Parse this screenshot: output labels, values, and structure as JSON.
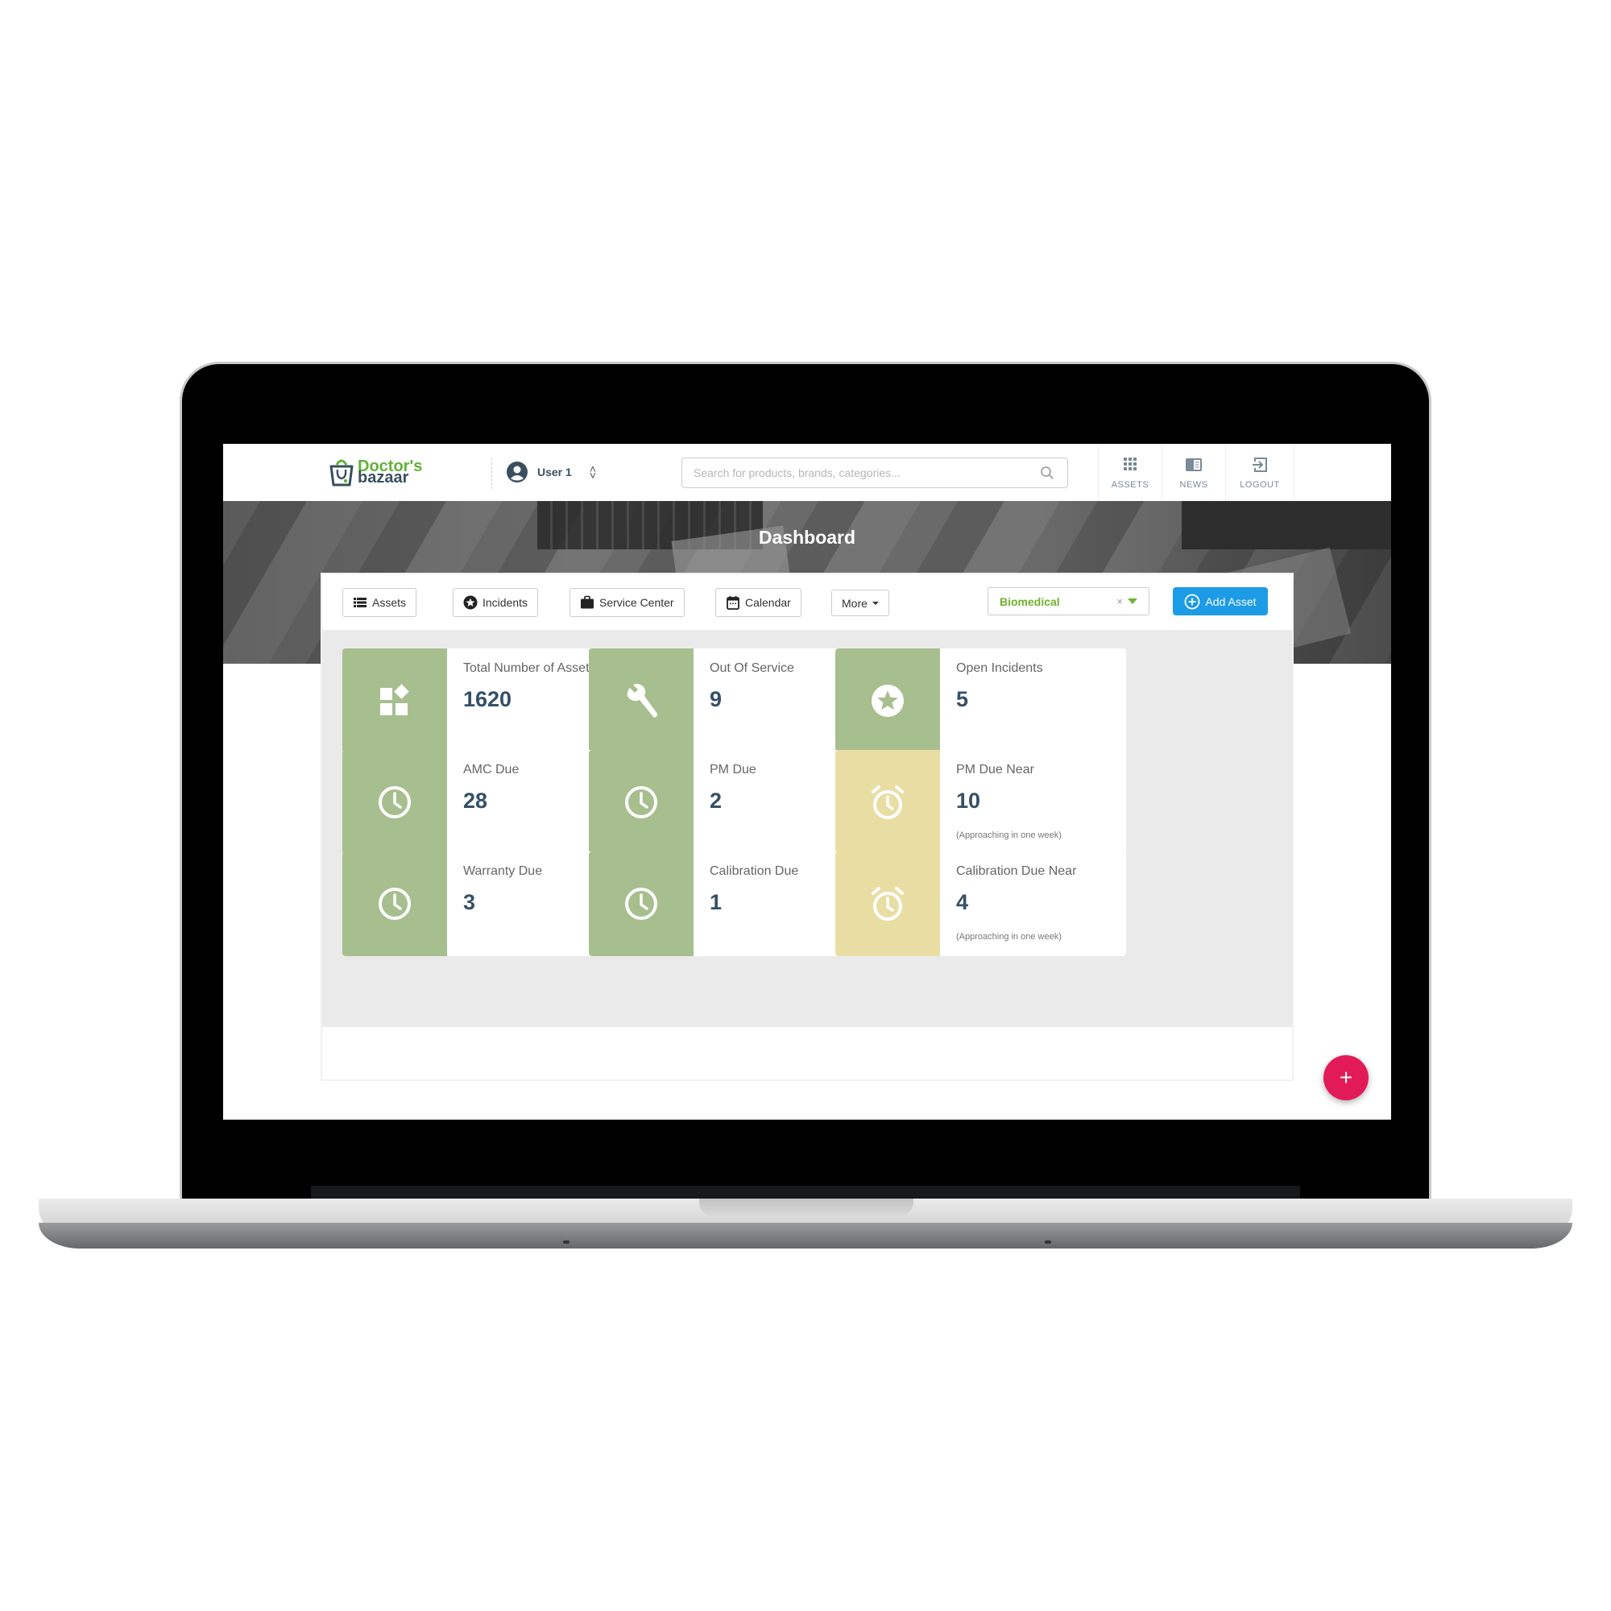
{
  "header": {
    "logo": {
      "line1": "Doctor's",
      "line2": "bazaar"
    },
    "user": {
      "name": "User 1",
      "toggle_icon": "chevron-up-down"
    },
    "search": {
      "placeholder": "Search for products, brands, categories...",
      "value": "",
      "icon": "search-icon"
    },
    "nav": [
      {
        "label": "ASSETS",
        "icon": "grid-icon"
      },
      {
        "label": "NEWS",
        "icon": "newspaper-icon"
      },
      {
        "label": "LOGOUT",
        "icon": "logout-icon"
      }
    ]
  },
  "banner": {
    "title": "Dashboard"
  },
  "toolbar": {
    "buttons": [
      {
        "label": "Assets",
        "icon": "list-icon"
      },
      {
        "label": "Incidents",
        "icon": "star-circle-icon"
      },
      {
        "label": "Service Center",
        "icon": "briefcase-icon"
      },
      {
        "label": "Calendar",
        "icon": "calendar-icon"
      },
      {
        "label": "More",
        "icon": "caret-down-icon"
      }
    ],
    "department_select": {
      "value": "Biomedical",
      "clear": "×"
    },
    "add_asset_label": "Add Asset"
  },
  "colors": {
    "green": "#a7bf8f",
    "yellow": "#e8dea4",
    "accent_blue": "#1c9be6",
    "fab": "#e21b58",
    "value_text": "#355068",
    "select_text": "#6fb22c"
  },
  "cards": [
    {
      "label": "Total Number of Assets",
      "value": "1620",
      "note": "",
      "icon": "widgets-icon",
      "tone": "green"
    },
    {
      "label": "Out Of Service",
      "value": "9",
      "note": "",
      "icon": "wrench-icon",
      "tone": "green"
    },
    {
      "label": "Open Incidents",
      "value": "5",
      "note": "",
      "icon": "star-circle-icon",
      "tone": "green"
    },
    {
      "label": "AMC Due",
      "value": "28",
      "note": "",
      "icon": "clock-icon",
      "tone": "green"
    },
    {
      "label": "PM Due",
      "value": "2",
      "note": "",
      "icon": "clock-icon",
      "tone": "green"
    },
    {
      "label": "PM Due Near",
      "value": "10",
      "note": "(Approaching in one week)",
      "icon": "alarm-icon",
      "tone": "yellow"
    },
    {
      "label": "Warranty Due",
      "value": "3",
      "note": "",
      "icon": "clock-icon",
      "tone": "green"
    },
    {
      "label": "Calibration Due",
      "value": "1",
      "note": "",
      "icon": "clock-icon",
      "tone": "green"
    },
    {
      "label": "Calibration Due Near",
      "value": "4",
      "note": "(Approaching in one week)",
      "icon": "alarm-icon",
      "tone": "yellow"
    }
  ],
  "fab": {
    "label": "+"
  }
}
